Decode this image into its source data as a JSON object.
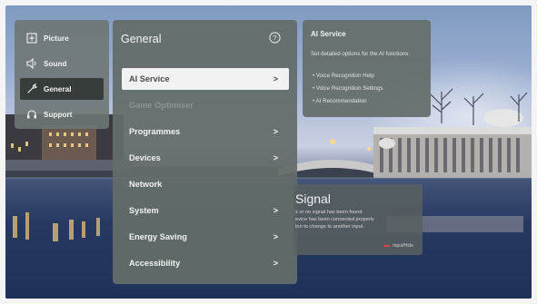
{
  "categories": [
    {
      "label": "Picture",
      "icon": "picture-icon",
      "selected": false
    },
    {
      "label": "Sound",
      "icon": "sound-icon",
      "selected": false
    },
    {
      "label": "General",
      "icon": "wrench-icon",
      "selected": true
    },
    {
      "label": "Support",
      "icon": "support-icon",
      "selected": false
    }
  ],
  "general": {
    "title": "General",
    "items": [
      {
        "label": "AI Service",
        "chevron": ">"
      },
      {
        "label": "Game Optimiser",
        "chevron": ""
      },
      {
        "label": "Programmes",
        "chevron": ">"
      },
      {
        "label": "Devices",
        "chevron": ">"
      },
      {
        "label": "Network",
        "chevron": ""
      },
      {
        "label": "System",
        "chevron": ">"
      },
      {
        "label": "Energy Saving",
        "chevron": ">"
      },
      {
        "label": "Accessibility",
        "chevron": ">"
      }
    ]
  },
  "info": {
    "title": "AI Service",
    "description": "Set detailed options for the AI functions.",
    "bullets": [
      "• Voice Recognition Help",
      "• Voice Recognition Settings",
      "• AI Recommendation"
    ]
  },
  "no_signal": {
    "title": "Signal",
    "line1": "s or no signal has been found.",
    "line2": "evice has been connected properly",
    "line3": "ton to change to another input.",
    "hint": "Input/Hide"
  },
  "colors": {
    "focus_bg": "#f2f2f2",
    "panel_bg": "#646c6a",
    "accent_red": "#e04545"
  }
}
